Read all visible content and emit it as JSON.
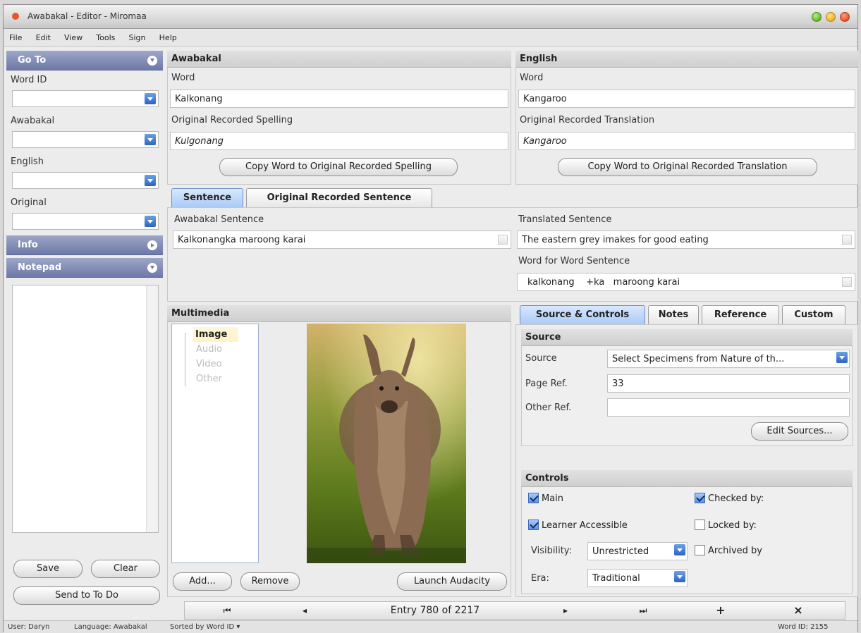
{
  "window": {
    "title": "Awabakal - Editor - Miromaa"
  },
  "menu": [
    "File",
    "Edit",
    "View",
    "Tools",
    "Sign",
    "Help"
  ],
  "sidebar": {
    "goto_title": "Go To",
    "fields": [
      {
        "label": "Word ID",
        "value": ""
      },
      {
        "label": "Awabakal",
        "value": ""
      },
      {
        "label": "English",
        "value": ""
      },
      {
        "label": "Original",
        "value": ""
      }
    ],
    "info_title": "Info",
    "notepad_title": "Notepad",
    "notepad_text": "",
    "save_label": "Save",
    "clear_label": "Clear",
    "send_label": "Send to To Do"
  },
  "awabakal": {
    "title": "Awabakal",
    "word_label": "Word",
    "word_value": "Kalkonang",
    "orig_label": "Original Recorded Spelling",
    "orig_value": "Kulgonang",
    "copy_label": "Copy Word to Original Recorded Spelling"
  },
  "english": {
    "title": "English",
    "word_label": "Word",
    "word_value": "Kangaroo",
    "orig_label": "Original Recorded Translation",
    "orig_value": "Kangaroo",
    "copy_label": "Copy Word to Original Recorded Translation"
  },
  "sentence_tabs": [
    "Sentence",
    "Original Recorded Sentence"
  ],
  "sentence": {
    "awabakal_label": "Awabakal Sentence",
    "awabakal_value": "Kalkonangka maroong karai",
    "translated_label": "Translated Sentence",
    "translated_value": "The eastern grey imakes for good eating",
    "wfw_label": "Word for Word Sentence",
    "wfw_value": "kalkonang    +ka   maroong karai"
  },
  "multimedia": {
    "title": "Multimedia",
    "tree": [
      "Image",
      "Audio",
      "Video",
      "Other"
    ],
    "add_label": "Add...",
    "remove_label": "Remove",
    "launch_label": "Launch Audacity"
  },
  "right_tabs": [
    "Source & Controls",
    "Notes",
    "Reference",
    "Custom"
  ],
  "source": {
    "title": "Source",
    "source_label": "Source",
    "source_value": "Select Specimens from Nature of th...",
    "page_label": "Page Ref.",
    "page_value": "33",
    "other_label": "Other Ref.",
    "other_value": "",
    "edit_label": "Edit Sources..."
  },
  "controls": {
    "title": "Controls",
    "main_label": "Main",
    "main_checked": true,
    "learner_label": "Learner Accessible",
    "learner_checked": true,
    "visibility_label": "Visibility:",
    "visibility_value": "Unrestricted",
    "era_label": "Era:",
    "era_value": "Traditional",
    "checked_by_label": "Checked by:",
    "checked_by_checked": true,
    "locked_by_label": "Locked by:",
    "locked_by_checked": false,
    "archived_by_label": "Archived by",
    "archived_by_checked": false
  },
  "nav": {
    "first": "⏮",
    "prev": "◂",
    "entry": "Entry 780 of 2217",
    "next": "▸",
    "last": "⏭",
    "add": "+",
    "delete": "×"
  },
  "status": {
    "user": "User: Daryn",
    "language": "Language: Awabakal",
    "sorted": "Sorted by Word ID ▾",
    "word_id": "Word ID: 2155"
  },
  "colors": {
    "accent": "#6d79a8",
    "tab_active": "#a9c9f4",
    "brand_dot": "#e25a2c"
  }
}
